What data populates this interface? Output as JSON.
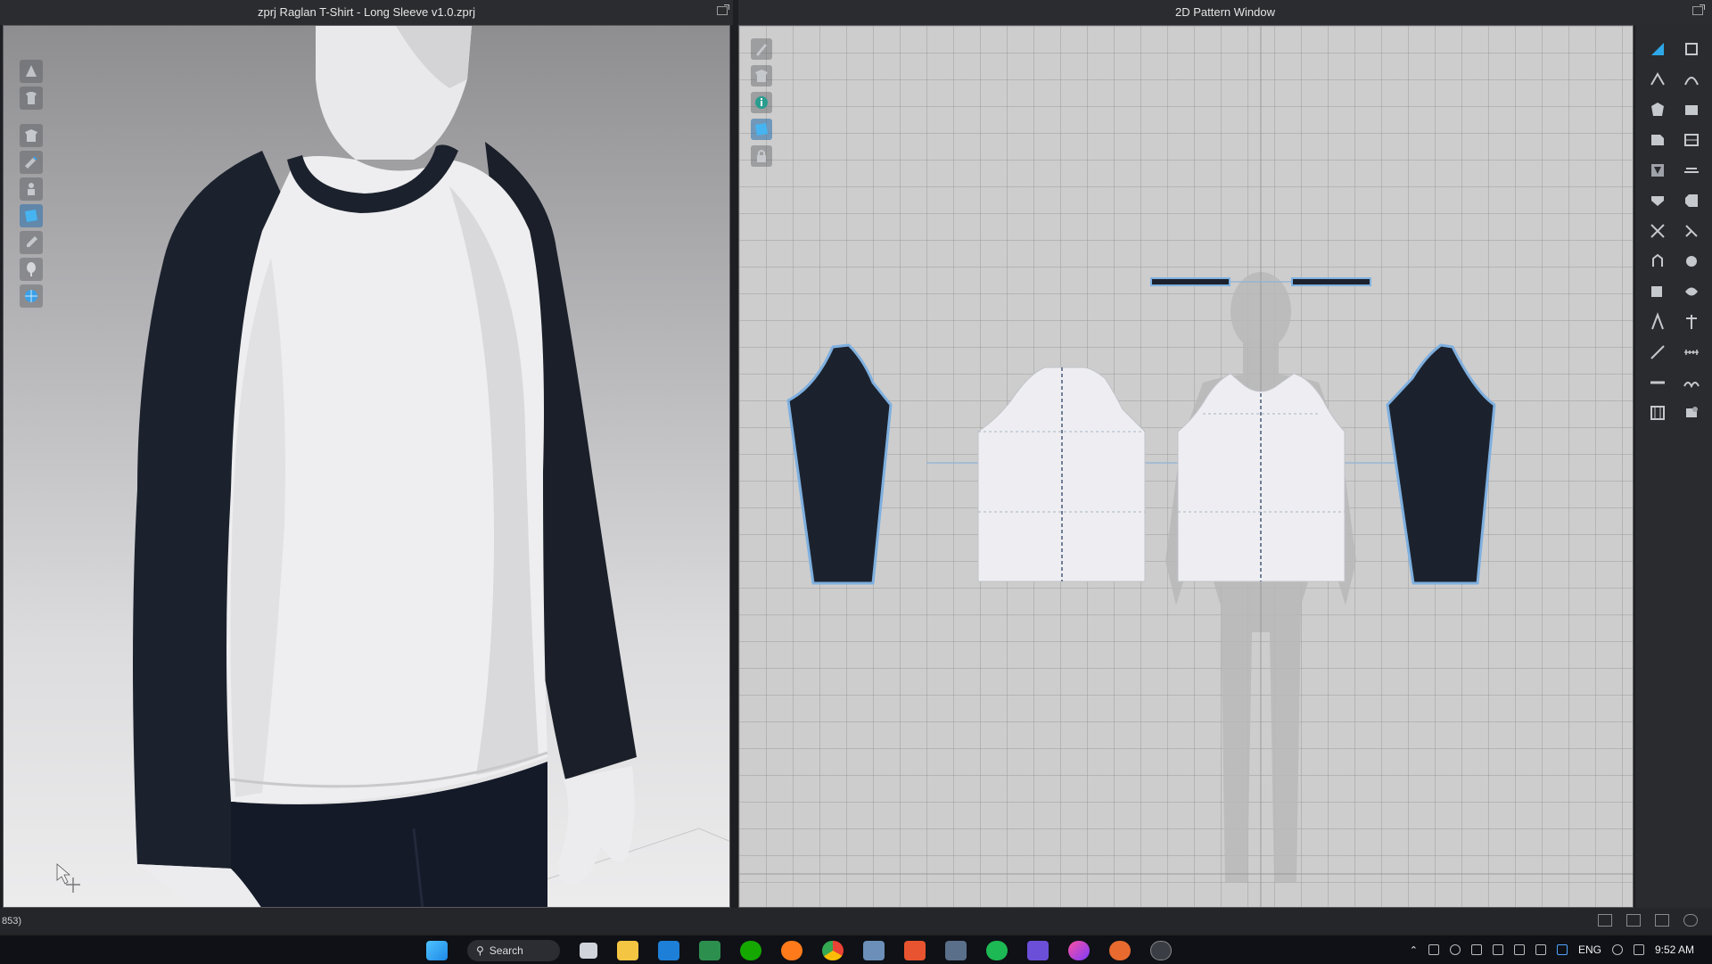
{
  "window": {
    "left_title": "zprj Raglan T-Shirt - Long Sleeve v1.0.zprj",
    "right_title": "2D Pattern Window"
  },
  "statusbar": {
    "text": "853)"
  },
  "taskbar": {
    "search_label": "Search",
    "language": "ENG",
    "time": "9:52 AM"
  },
  "colors": {
    "sleeve_fabric": "#1c222d",
    "body_fabric": "#eeeef0",
    "pattern_outline": "#7fb0e0",
    "accent_blue": "#2e8fd8"
  },
  "tools_3d": [
    "simulation-icon",
    "avatar-icon",
    "select-mesh-icon",
    "edit-pattern-icon",
    "transform-icon",
    "texture-icon",
    "brush-icon",
    "pin-icon",
    "sphere-icon"
  ],
  "tools_2d": [
    "transform-pattern-icon",
    "edit-curvature-icon",
    "info-icon",
    "texture-edit-icon",
    "lock-icon"
  ],
  "tools_right": [
    "select-pattern-icon",
    "transform-point-icon",
    "edit-point-icon",
    "curve-point-icon",
    "polygon-icon",
    "rectangle-icon",
    "ellipse-icon",
    "internal-polygon-icon",
    "dart-icon",
    "notch-icon",
    "seam-line-icon",
    "free-sewing-icon",
    "fold-icon",
    "trim-icon",
    "zipper-icon",
    "button-icon",
    "elastic-icon",
    "topstitch-icon",
    "text-icon",
    "bold-text-icon",
    "measure-icon",
    "ruler-icon",
    "gridline-icon",
    "puckering-icon",
    "graphic-icon",
    "pleat-icon"
  ]
}
